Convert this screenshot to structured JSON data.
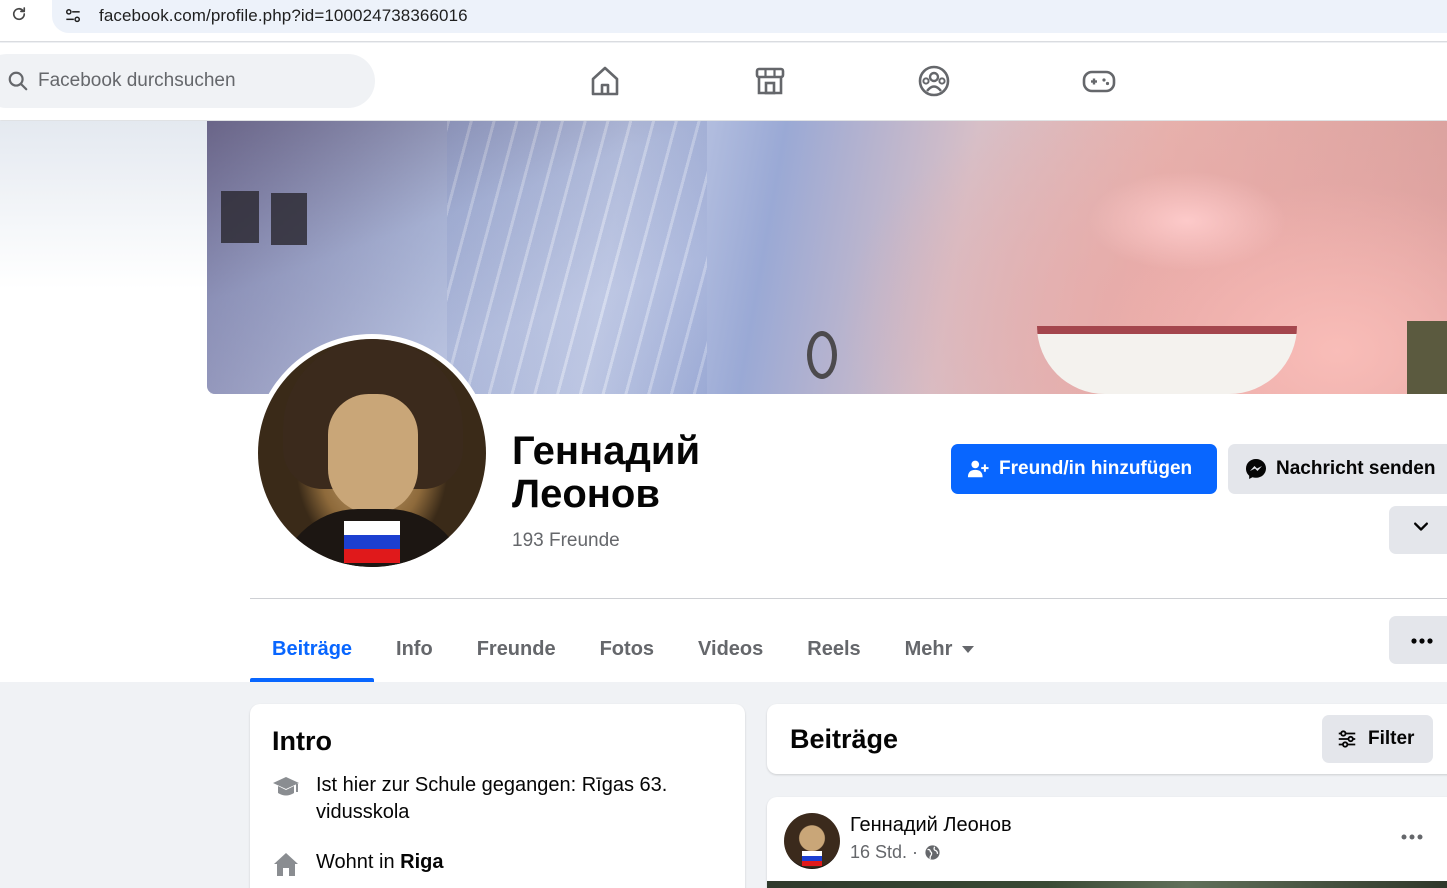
{
  "browser": {
    "url": "facebook.com/profile.php?id=100024738366016"
  },
  "header": {
    "search_placeholder": "Facebook durchsuchen",
    "nav_icons": [
      "home-icon",
      "marketplace-icon",
      "groups-icon",
      "gaming-icon"
    ]
  },
  "profile": {
    "name_line1": "Геннадий",
    "name_line2": "Леонов",
    "friends": "193 Freunde",
    "add_friend_label": "Freund/in hinzufügen",
    "message_label": "Nachricht senden"
  },
  "tabs": [
    {
      "label": "Beiträge",
      "active": true
    },
    {
      "label": "Info"
    },
    {
      "label": "Freunde"
    },
    {
      "label": "Fotos"
    },
    {
      "label": "Videos"
    },
    {
      "label": "Reels"
    },
    {
      "label": "Mehr"
    }
  ],
  "intro": {
    "title": "Intro",
    "school_text": "Ist hier zur Schule gegangen: Rīgas 63. vidusskola",
    "lives_prefix": "Wohnt in ",
    "lives_city": "Riga"
  },
  "posts": {
    "title": "Beiträge",
    "filter_label": "Filter",
    "first_post": {
      "author": "Геннадий Леонов",
      "time": "16 Std. ·"
    }
  },
  "colors": {
    "accent": "#0866ff",
    "secondary_button": "#e4e6eb",
    "muted_text": "#65676b"
  }
}
